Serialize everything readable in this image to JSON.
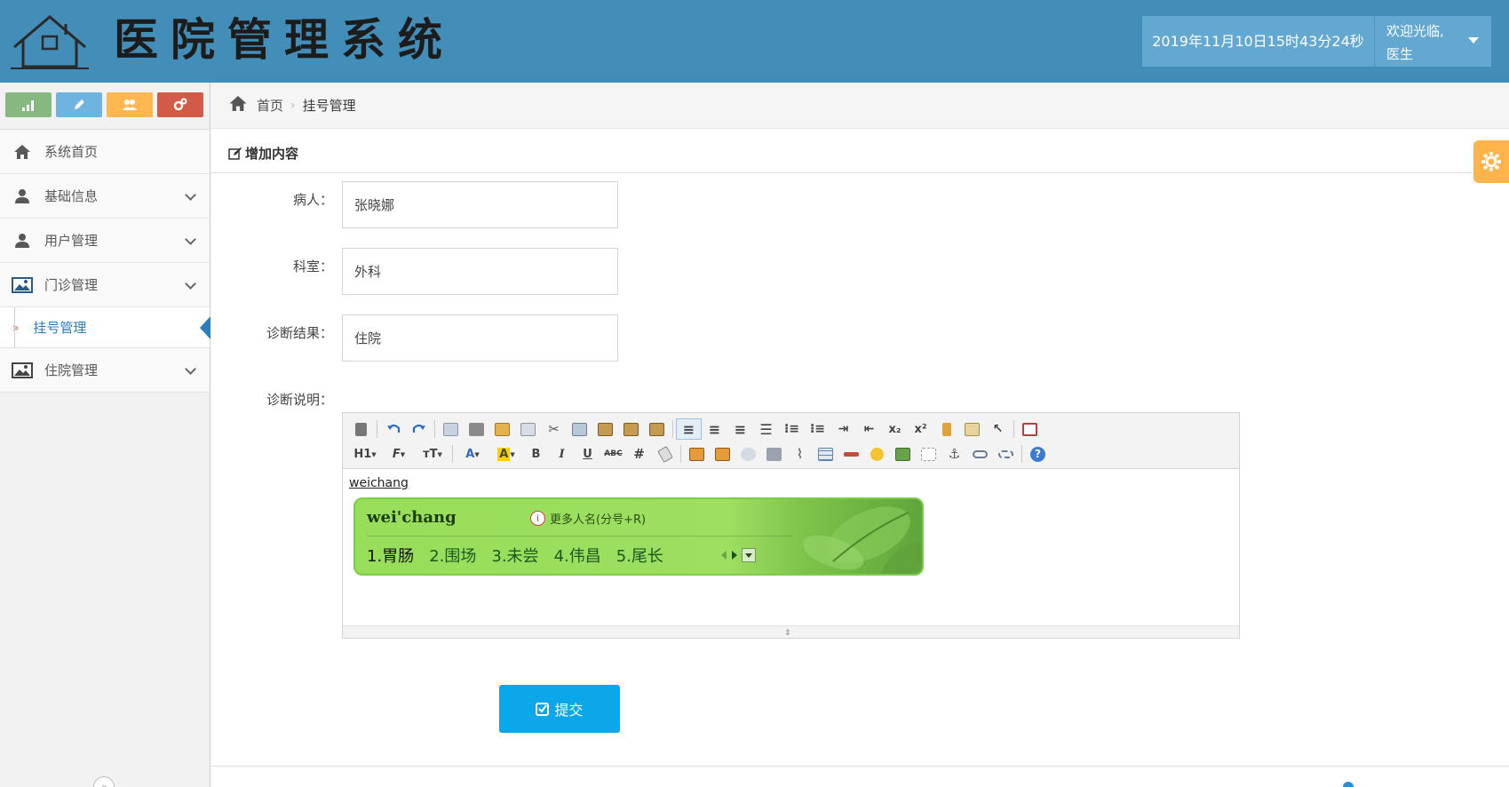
{
  "header": {
    "title": "医院管理系统",
    "datetime": "2019年11月10日15时43分24秒",
    "welcome_line1": "欢迎光临,",
    "welcome_line2": "医生",
    "bg_color": "#438eb9"
  },
  "sidebar": {
    "shortcuts": [
      {
        "icon": "signal-icon",
        "color": "#87b87f"
      },
      {
        "icon": "pencil-icon",
        "color": "#6fb3e0"
      },
      {
        "icon": "users-icon",
        "color": "#ffb752"
      },
      {
        "icon": "cogs-icon",
        "color": "#d15b47"
      }
    ],
    "items": [
      {
        "label": "系统首页",
        "icon": "home-icon"
      },
      {
        "label": "基础信息",
        "icon": "user-icon"
      },
      {
        "label": "用户管理",
        "icon": "user-icon"
      },
      {
        "label": "门诊管理",
        "icon": "picture-icon"
      },
      {
        "label": "住院管理",
        "icon": "picture-icon"
      }
    ],
    "sub_item": {
      "label": "挂号管理",
      "active": true
    }
  },
  "breadcrumb": {
    "home": "首页",
    "current": "挂号管理"
  },
  "form": {
    "section_title": "增加内容",
    "patient_label": "病人：",
    "patient_value": "张晓娜",
    "department_label": "科室：",
    "department_value": "外科",
    "result_label": "诊断结果：",
    "result_value": "住院",
    "description_label": "诊断说明：",
    "editor_text": "weichang",
    "submit_label": "提交"
  },
  "toolbar_text": {
    "heading": "H1",
    "font": "F",
    "size": "тT",
    "fontcolor": "A",
    "bgcolor": "A",
    "bold": "B",
    "italic": "I",
    "underline": "U",
    "strike": "ABC",
    "sub": "x₂",
    "sup": "x²"
  },
  "ime": {
    "pinyin": "wei'chang",
    "more_text": "更多人名(分号+R)",
    "candidates": [
      "1.胃肠",
      "2.围场",
      "3.未尝",
      "4.伟昌",
      "5.尾长"
    ]
  },
  "colors": {
    "accent": "#438eb9",
    "submit": "#0ba7e8",
    "settings": "#ffb44b",
    "active_link": "#2b7dbc"
  }
}
